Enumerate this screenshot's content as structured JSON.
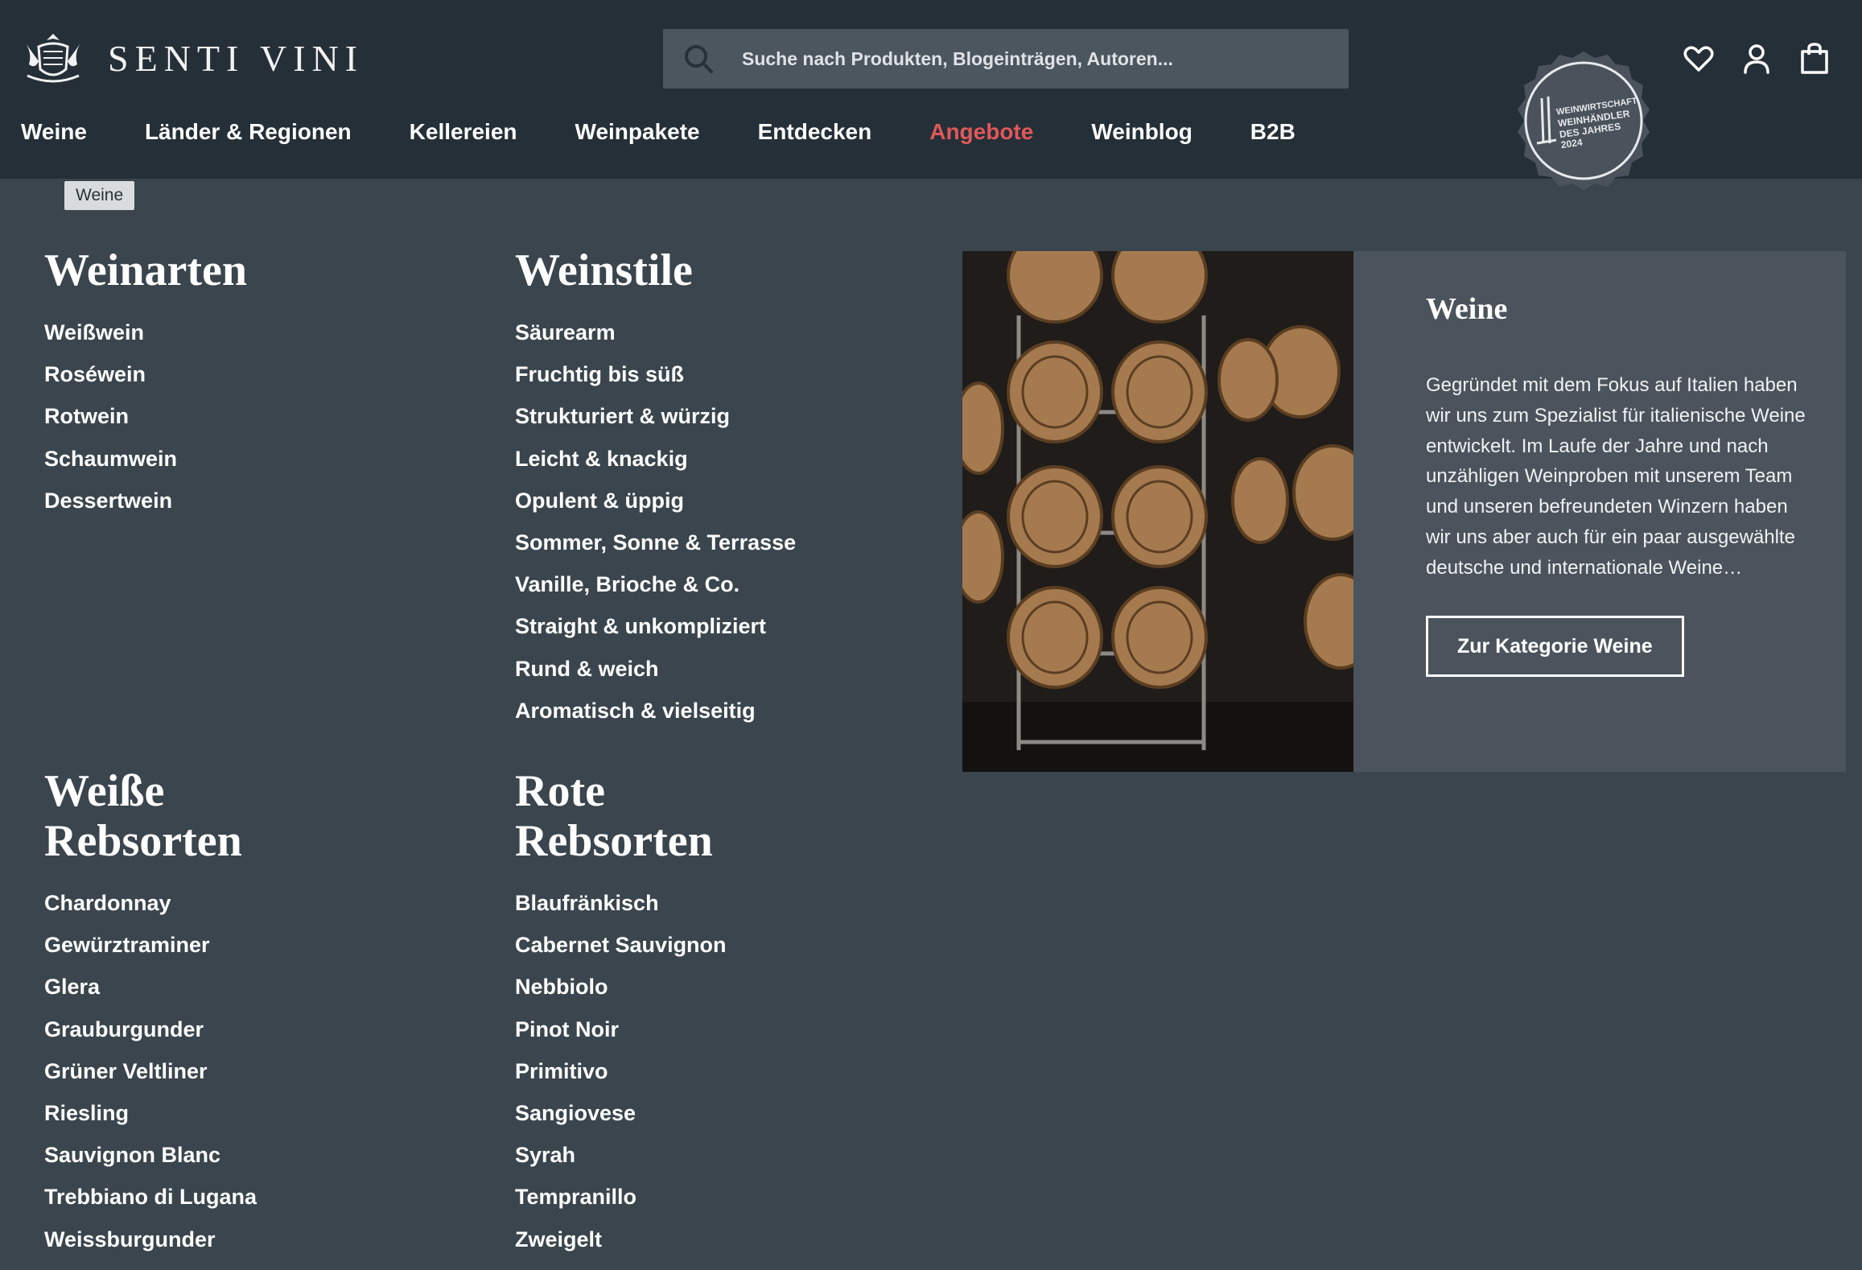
{
  "brand": {
    "name": "SENTI VINI"
  },
  "search": {
    "placeholder": "Suche nach Produkten, Blogeinträgen, Autoren..."
  },
  "nav": {
    "items": [
      {
        "label": "Weine"
      },
      {
        "label": "Länder & Regionen"
      },
      {
        "label": "Kellereien"
      },
      {
        "label": "Weinpakete"
      },
      {
        "label": "Entdecken"
      },
      {
        "label": "Angebote"
      },
      {
        "label": "Weinblog"
      },
      {
        "label": "B2B"
      }
    ],
    "highlight_color": "#e0585a"
  },
  "badge": {
    "line1": "WEINWIRTSCHAFT",
    "line2": "WEINHÄNDLER",
    "line3": "DES JAHRES",
    "line4": "2024"
  },
  "header_icons": [
    "heart-icon",
    "user-icon",
    "shopping-bag-icon"
  ],
  "tooltip": {
    "label": "Weine"
  },
  "menu": {
    "weinarten": {
      "title": "Weinarten",
      "items": [
        "Weißwein",
        "Roséwein",
        "Rotwein",
        "Schaumwein",
        "Dessertwein"
      ]
    },
    "weinstile": {
      "title": "Weinstile",
      "items": [
        "Säurearm",
        "Fruchtig bis süß",
        "Strukturiert & würzig",
        "Leicht & knackig",
        "Opulent & üppig",
        "Sommer, Sonne & Terrasse",
        "Vanille, Brioche & Co.",
        "Straight & unkompliziert",
        "Rund & weich",
        "Aromatisch & vielseitig"
      ]
    },
    "weisse": {
      "title_line1": "Weiße",
      "title_line2": "Rebsorten",
      "items": [
        "Chardonnay",
        "Gewürztraminer",
        "Glera",
        "Grauburgunder",
        "Grüner Veltliner",
        "Riesling",
        "Sauvignon Blanc",
        "Trebbiano di Lugana",
        "Weissburgunder"
      ]
    },
    "rote": {
      "title_line1": "Rote",
      "title_line2": "Rebsorten",
      "items": [
        "Blaufränkisch",
        "Cabernet Sauvignon",
        "Nebbiolo",
        "Pinot Noir",
        "Primitivo",
        "Sangiovese",
        "Syrah",
        "Tempranillo",
        "Zweigelt"
      ]
    }
  },
  "promo": {
    "title": "Weine",
    "text": "Gegründet mit dem Fokus auf Italien haben wir uns zum Spezialist für italienische Weine entwickelt. Im Laufe der Jahre und nach unzähligen Weinproben mit unserem Team und unseren befreundeten Winzern haben wir uns aber auch für ein paar ausgewählte deutsche und internationale Weine…",
    "button": "Zur Kategorie Weine"
  }
}
